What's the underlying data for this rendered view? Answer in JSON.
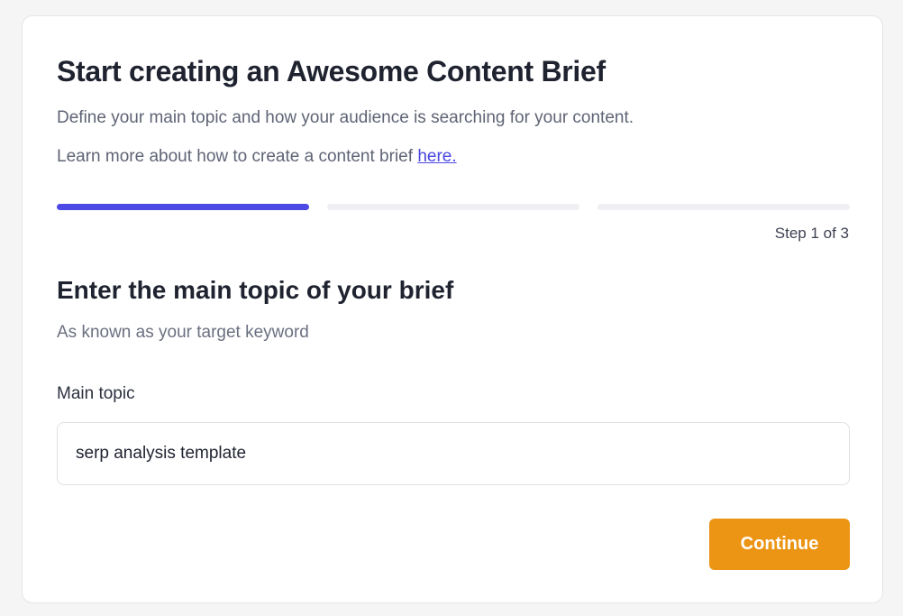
{
  "header": {
    "title": "Start creating an Awesome Content Brief",
    "description": "Define your main topic and how your audience is searching for your content.",
    "learn_more_prefix": "Learn more about how to create a content brief ",
    "learn_more_link": "here."
  },
  "progress": {
    "current_step": 1,
    "total_steps": 3,
    "step_label": "Step 1 of 3"
  },
  "step": {
    "title": "Enter the main topic of your brief",
    "hint": "As known as your target keyword"
  },
  "form": {
    "main_topic_label": "Main topic",
    "main_topic_value": "serp analysis template",
    "continue_label": "Continue"
  },
  "colors": {
    "accent": "#4d49e4",
    "button": "#ec9413",
    "link": "#4b47e0"
  }
}
